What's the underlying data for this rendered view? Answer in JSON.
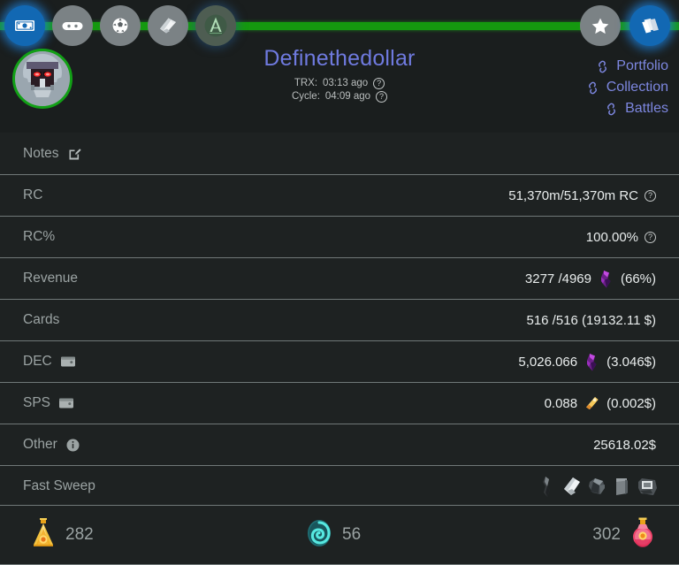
{
  "theme": {
    "page_bg": "#1b1f1f",
    "row_bg": "#1e2222",
    "row_divider": "#707878",
    "label_color": "#9ba3a3",
    "value_color": "#e9eded",
    "accent_title": "#6f7adf",
    "accent_link": "#7d87e0",
    "progress_green": "#15990f",
    "active_blue": "#1268b3",
    "avatar_ring_green": "#12a016"
  },
  "navbar": {
    "progress_bar": {
      "name": "green-progress-bar",
      "fill_percent": 100
    },
    "left_icons": [
      {
        "name": "banknote-icon",
        "label": "Banknote",
        "state": "active"
      },
      {
        "name": "gamepad-icon",
        "label": "Gamepad",
        "state": "inactive"
      },
      {
        "name": "soccer-ball-icon",
        "label": "Soccer Ball",
        "state": "inactive"
      },
      {
        "name": "scroll-icon",
        "label": "Scroll",
        "state": "inactive"
      },
      {
        "name": "letter-a-emblem-icon",
        "label": "A Emblem",
        "state": "dim"
      }
    ],
    "right_icons": [
      {
        "name": "star-icon",
        "label": "Star",
        "state": "inactive"
      },
      {
        "name": "card-stack-icon",
        "label": "Card Stack",
        "state": "active"
      }
    ]
  },
  "avatar": {
    "name": "player-avatar",
    "alt": "Robot mech avatar"
  },
  "header": {
    "title": "Definethedollar",
    "trx_label": "TRX:",
    "trx_value": "03:13 ago",
    "cycle_label": "Cycle:",
    "cycle_value": "04:09 ago",
    "help_glyph": "?"
  },
  "links": [
    {
      "label": "Portfolio",
      "icon": "link-chain-icon"
    },
    {
      "label": "Collection",
      "icon": "link-chain-icon"
    },
    {
      "label": "Battles",
      "icon": "link-chain-icon"
    }
  ],
  "rows": {
    "notes": {
      "label": "Notes",
      "icon": "edit-pencil-icon"
    },
    "rc": {
      "label": "RC",
      "value": "51,370m/51,370m RC",
      "help": "?"
    },
    "rc_pct": {
      "label": "RC%",
      "value": "100.00%",
      "help": "?"
    },
    "revenue": {
      "label": "Revenue",
      "value": "3277 /4969",
      "suffix": "(66%)",
      "token": "dec-crystal-icon"
    },
    "cards": {
      "label": "Cards",
      "value": "516 /516 (19132.11 $)"
    },
    "dec": {
      "label": "DEC",
      "icon": "wallet-icon",
      "value": "5,026.066",
      "suffix": "(3.046$)",
      "token": "dec-crystal-icon"
    },
    "sps": {
      "label": "SPS",
      "icon": "wallet-icon",
      "value": "0.088",
      "suffix": "(0.002$)",
      "token": "sps-token-icon"
    },
    "other": {
      "label": "Other",
      "icon": "info-circle-icon",
      "value": "25618.02$"
    },
    "fast_sweep": {
      "label": "Fast Sweep",
      "items": [
        {
          "name": "sweep-item-1-icon",
          "label": "Dark Shard"
        },
        {
          "name": "sweep-item-2-icon",
          "label": "White Scroll"
        },
        {
          "name": "sweep-item-3-icon",
          "label": "Crumpled Ore"
        },
        {
          "name": "sweep-item-4-icon",
          "label": "Grey Tablet"
        },
        {
          "name": "sweep-item-5-icon",
          "label": "Framed Relic"
        }
      ]
    }
  },
  "bottom_bar": {
    "left": {
      "icon": "gold-potion-icon",
      "value": "282"
    },
    "middle": {
      "icon": "teal-spiral-icon",
      "value": "56"
    },
    "right": {
      "icon": "red-potion-icon",
      "value": "302"
    }
  }
}
